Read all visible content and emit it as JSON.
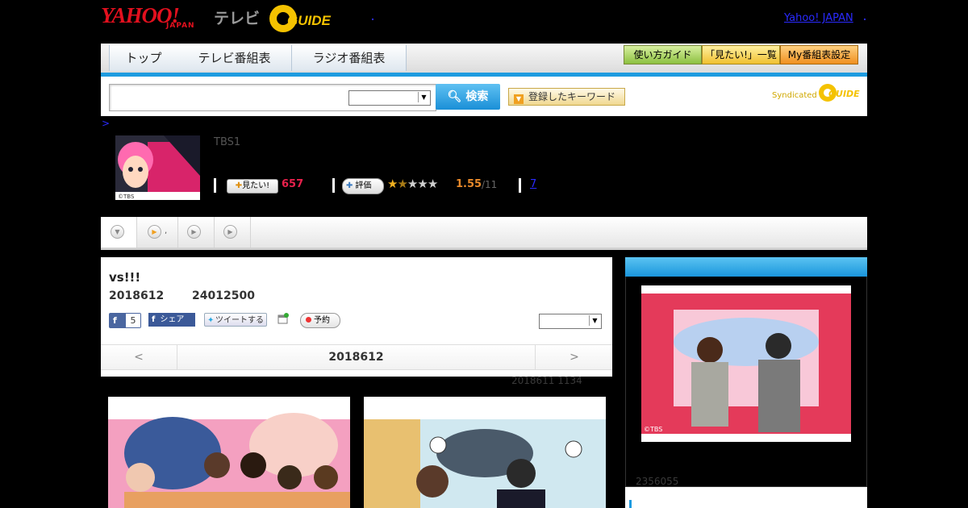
{
  "header": {
    "brand_yahoo": "YAHOO!",
    "brand_yahoo_sub": "JAPAN",
    "brand_tv": "テレビ",
    "brand_gguide": "GUIDE",
    "top_link": "Yahoo! JAPAN"
  },
  "nav": {
    "tabs": [
      "トップ",
      "テレビ番組表",
      "ラジオ番組表"
    ],
    "buttons": [
      "使い方ガイド",
      "「見たい!」一覧",
      "My番組表設定"
    ]
  },
  "search": {
    "input_value": "",
    "select_value": "",
    "button_label": "検索",
    "keyword_button": "登録したキーワード",
    "syndicated_label": "Syndicated",
    "syndicated_brand": "GUIDE"
  },
  "breadcrumb": ">",
  "program": {
    "thumb_caption": "©TBS",
    "channel": "TBS1",
    "want_label": "見たい!",
    "want_count": "657",
    "rate_label": "評価",
    "rating": "1.55",
    "rating_count": "/11",
    "review_count": "7",
    "rating_value": 1.55,
    "rating_max": 5
  },
  "tabs": {
    "items": [
      "",
      ",",
      "",
      ""
    ]
  },
  "detail": {
    "title": "vs!!!",
    "date": "2018612",
    "time": "24012500",
    "fb_like_count": "5",
    "fb_share": "シェア",
    "tweet": "ツイートする",
    "reserve": "予約",
    "select_value": "",
    "nav_prev": "<",
    "nav_label": "2018612",
    "nav_next": ">"
  },
  "updated": "2018611  1134",
  "photos": [
    {
      "caption": ""
    },
    {
      "caption": ""
    }
  ],
  "sidebar": {
    "image_caption": "©TBS",
    "count": "2356055"
  },
  "colors": {
    "accent_blue": "#1e9be0",
    "want_pink": "#e8214c",
    "rating_orange": "#e8892a",
    "link_blue": "#2a2aff"
  }
}
